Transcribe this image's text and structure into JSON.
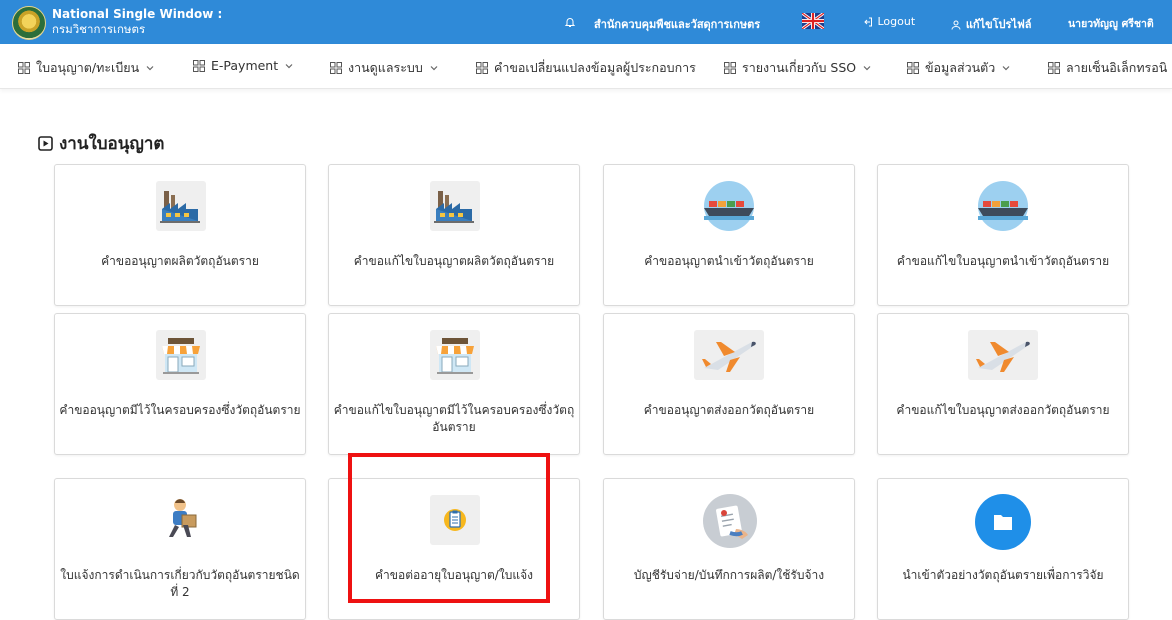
{
  "header": {
    "brand_line1": "National Single Window :",
    "brand_line2": "กรมวิชาการเกษตร",
    "office": "สำนักควบคุมพืชและวัสดุการเกษตร",
    "logout": "Logout",
    "edit_profile": "แก้ไขโปรไฟล์",
    "user_name": "นายวทัญญู ศรีชาติ"
  },
  "menu": {
    "items": [
      {
        "label": "ใบอนุญาต/ทะเบียน"
      },
      {
        "label": "E-Payment"
      },
      {
        "label": "งานดูแลระบบ"
      },
      {
        "label": "คำขอเปลี่ยนแปลงข้อมูลผู้ประกอบการ"
      },
      {
        "label": "รายงานเกี่ยวกับ SSO"
      },
      {
        "label": "ข้อมูลส่วนตัว"
      },
      {
        "label": "ลายเซ็นอิเล็กทรอนิ"
      }
    ]
  },
  "section": {
    "title": "งานใบอนุญาต"
  },
  "cards": [
    {
      "label": "คำขออนุญาตผลิตวัตถุอันตราย",
      "icon": "factory-icon"
    },
    {
      "label": "คำขอแก้ไขใบอนุญาตผลิตวัตถุอันตราย",
      "icon": "factory-icon"
    },
    {
      "label": "คำขออนุญาตนำเข้าวัตถุอันตราย",
      "icon": "cargo-ship-icon"
    },
    {
      "label": "คำขอแก้ไขใบอนุญาตนำเข้าวัตถุอันตราย",
      "icon": "cargo-ship-icon"
    },
    {
      "label": "คำขออนุญาตมีไว้ในครอบครองซึ่งวัตถุอันตราย",
      "icon": "store-icon"
    },
    {
      "label": "คำขอแก้ไขใบอนุญาตมีไว้ในครอบครองซึ่งวัตถุอันตราย",
      "icon": "store-icon"
    },
    {
      "label": "คำขออนุญาตส่งออกวัตถุอันตราย",
      "icon": "airplane-icon"
    },
    {
      "label": "คำขอแก้ไขใบอนุญาตส่งออกวัตถุอันตราย",
      "icon": "airplane-icon"
    },
    {
      "label": "ใบแจ้งการดำเนินการเกี่ยวกับวัตถุอันตรายชนิดที่ 2",
      "icon": "delivery-man-icon"
    },
    {
      "label": "คำขอต่ออายุใบอนุญาต/ใบแจ้ง",
      "icon": "clipboard-icon"
    },
    {
      "label": "บัญชีรับจ่าย/บันทึกการผลิต/ใช้รับจ้าง",
      "icon": "document-hand-icon"
    },
    {
      "label": "นำเข้าตัวอย่างวัตถุอันตรายเพื่อการวิจัย",
      "icon": "folder-icon"
    }
  ]
}
